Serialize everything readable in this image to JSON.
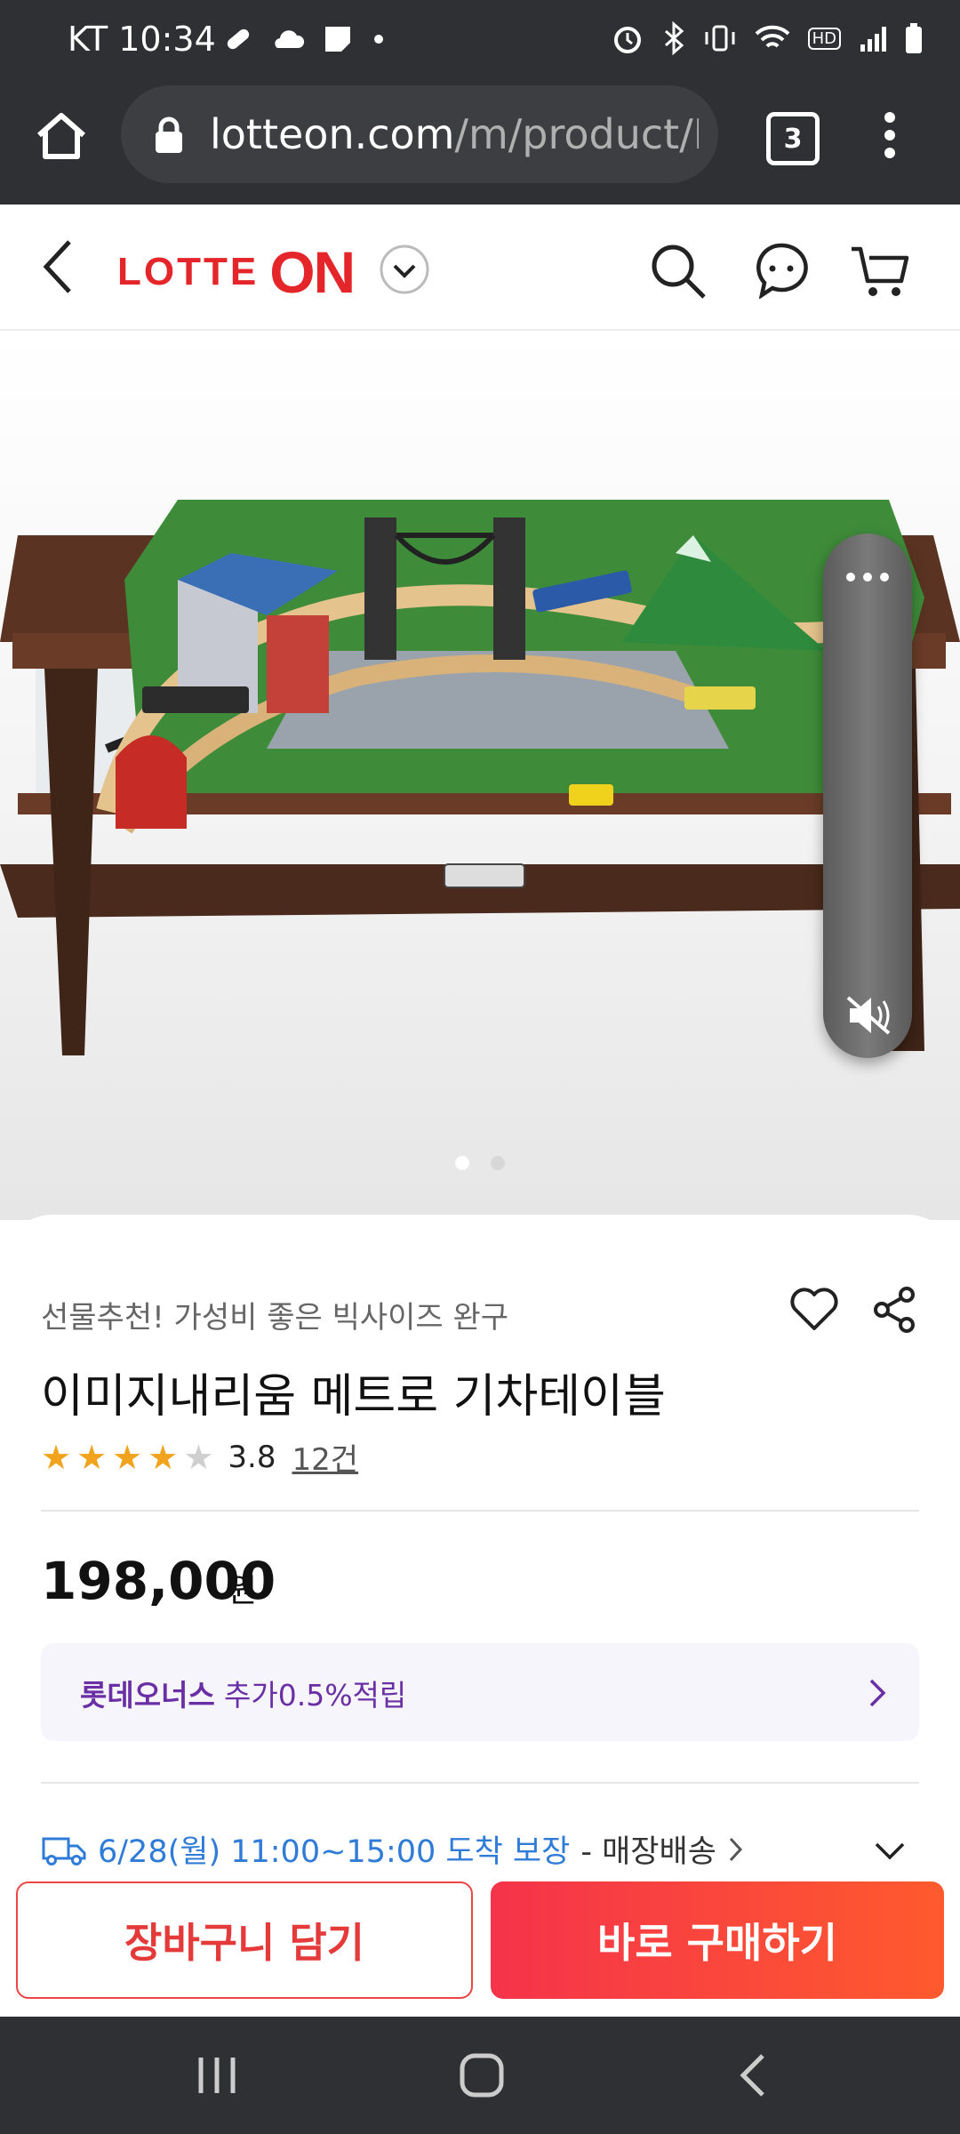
{
  "status_bar": {
    "carrier_time": "KT 10:34",
    "hd_badge": "HD"
  },
  "browser": {
    "url_domain": "lotteon.com",
    "url_path": "/m/product/LM",
    "tab_count": "3"
  },
  "header": {
    "logo_text_left": "LOTTE",
    "logo_text_right": "ON"
  },
  "product": {
    "promo_text": "선물추천! 가성비 좋은 빅사이즈 완구",
    "title": "이미지내리움 메트로 기차테이블",
    "rating_value": "3.8",
    "review_count": "12건",
    "price": "198,000",
    "price_unit": "원",
    "stars_filled": 4,
    "stars_total": 5,
    "image_page_count": 2,
    "image_page_active": 1
  },
  "bonus": {
    "brand": "롯데오너스",
    "desc": "추가0.5%적립"
  },
  "delivery": {
    "date_text": "6/28(월) 11:00~15:00 도착 보장",
    "type_text": "- 매장배송"
  },
  "actions": {
    "cart_label": "장바구니 담기",
    "buy_label": "바로 구매하기"
  },
  "colors": {
    "brand_red": "#e4262b",
    "star": "#f2a31e",
    "link_blue": "#2f7bd8",
    "bonus_purple": "#6a2fa4"
  }
}
